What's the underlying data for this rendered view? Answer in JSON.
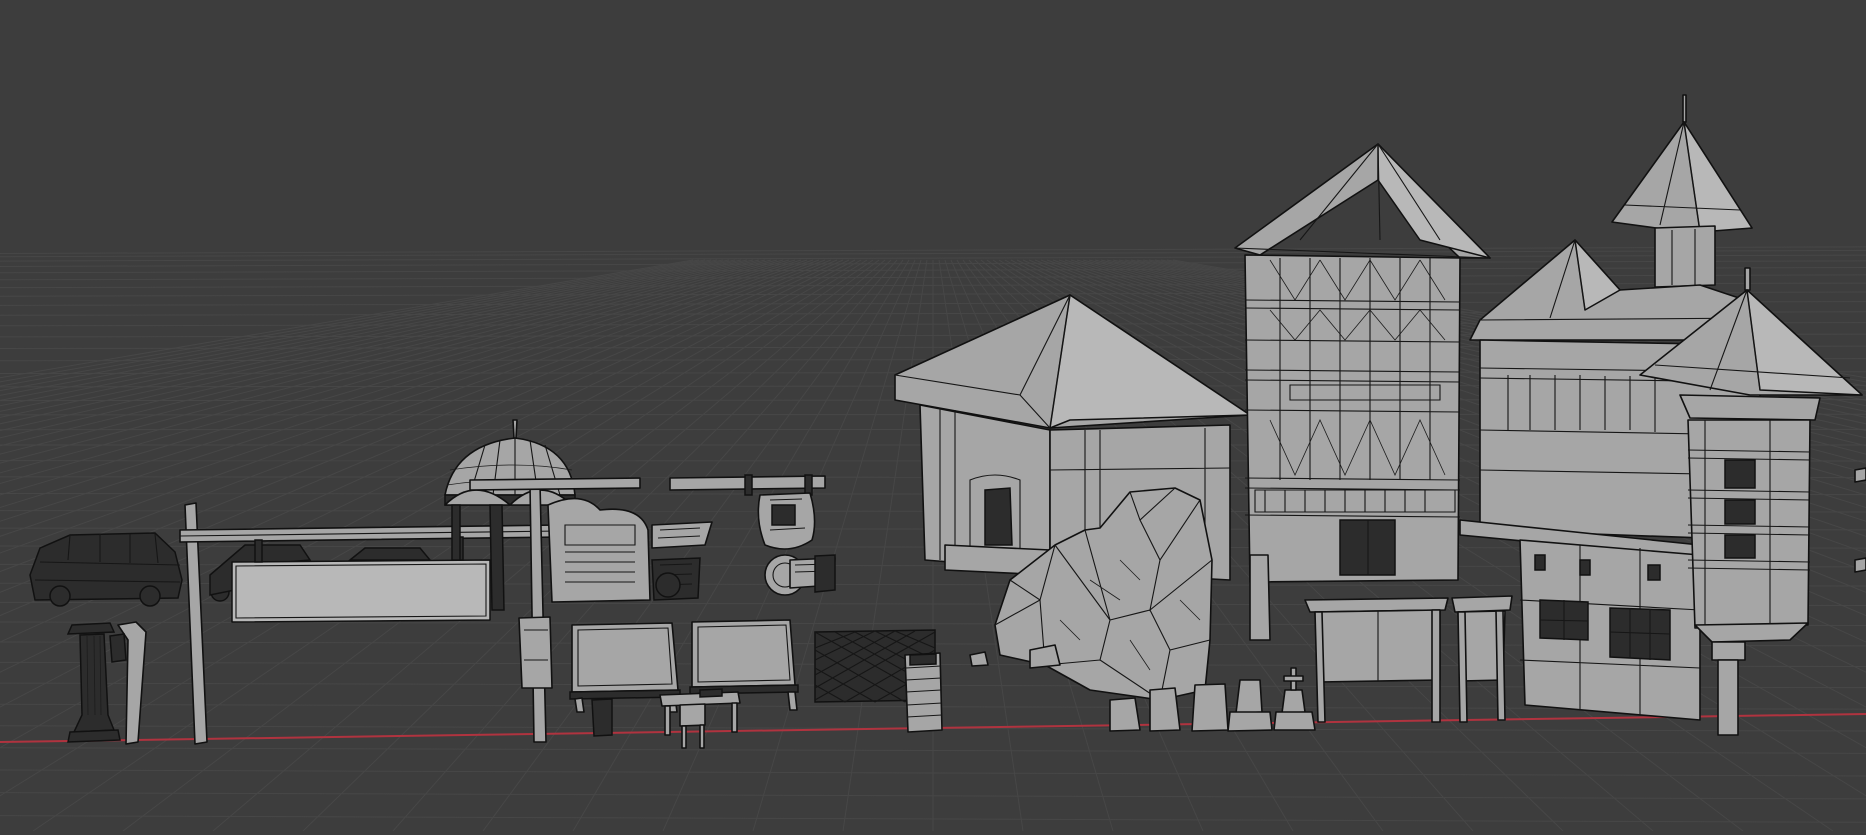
{
  "viewport": {
    "background": "#3d3d3d",
    "grid_color": "#474747",
    "x_axis_color": "#b0333f",
    "mesh_color": "#a6a6a6",
    "wire_color": "#111111"
  },
  "objects": [
    "van",
    "pillar",
    "lamp-post",
    "gate-sign",
    "gazebo",
    "notice-board",
    "market-stall",
    "hanging-shield-sign",
    "bench",
    "billboard-left",
    "billboard-right",
    "table",
    "chair",
    "fence-panel",
    "crate-stack",
    "cottage",
    "rock-formation",
    "tudor-tower",
    "gravestones",
    "bulletin-board",
    "tall-sign",
    "castle-building"
  ]
}
